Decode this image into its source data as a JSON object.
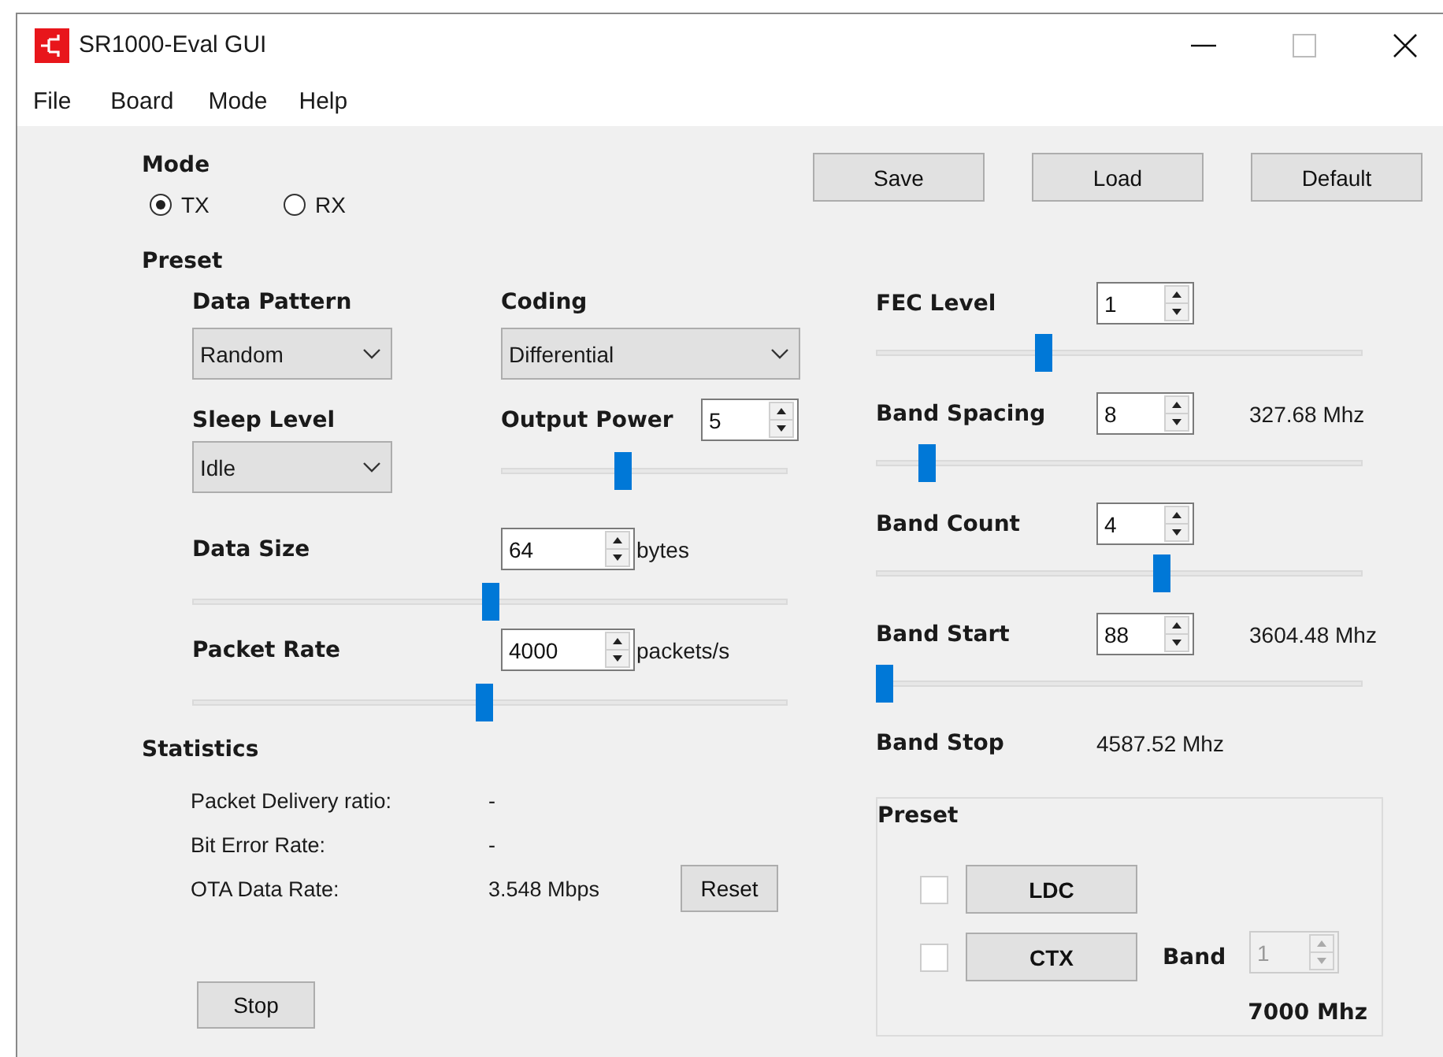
{
  "window": {
    "title": "SR1000-Eval GUI"
  },
  "menu": [
    "File",
    "Board",
    "Mode",
    "Help"
  ],
  "mode": {
    "label": "Mode",
    "options": [
      {
        "label": "TX",
        "selected": true
      },
      {
        "label": "RX",
        "selected": false
      }
    ]
  },
  "actions": [
    "Save",
    "Load",
    "Default"
  ],
  "preset": {
    "label": "Preset",
    "data_pattern": {
      "label": "Data Pattern",
      "value": "Random"
    },
    "coding": {
      "label": "Coding",
      "value": "Differential"
    },
    "sleep_level": {
      "label": "Sleep Level",
      "value": "Idle"
    },
    "output_power": {
      "label": "Output Power",
      "value": "5",
      "level": 0.42
    }
  },
  "traffic": [
    {
      "label": "Data Size",
      "value": "64",
      "unit": "bytes",
      "level": 0.5
    },
    {
      "label": "Packet Rate",
      "value": "4000",
      "unit": "packets/s",
      "level": 0.49
    }
  ],
  "statistics": {
    "title": "Statistics",
    "rows": [
      {
        "label": "Packet Delivery ratio:",
        "value": "-"
      },
      {
        "label": "Bit Error Rate:",
        "value": "-"
      },
      {
        "label": "OTA Data Rate:",
        "value": "3.548 Mbps"
      }
    ],
    "reset": "Reset"
  },
  "stop": "Stop",
  "band_params": [
    {
      "label": "FEC Level",
      "value": "1",
      "level": 0.34
    },
    {
      "label": "Band Spacing",
      "value": "8",
      "reading": "327.68 Mhz",
      "level": 0.09
    },
    {
      "label": "Band Count",
      "value": "4",
      "level": 0.59
    },
    {
      "label": "Band Start",
      "value": "88",
      "reading": "3604.48 Mhz",
      "level": 0.0
    }
  ],
  "band_stop": {
    "label": "Band Stop",
    "value": "4587.52 Mhz"
  },
  "band_preset": {
    "title": "Preset",
    "items": [
      {
        "label": "LDC",
        "checked": false
      },
      {
        "label": "CTX",
        "checked": false
      }
    ],
    "band": {
      "label": "Band",
      "value": "1",
      "disabled": true
    },
    "frequency": "7000 Mhz"
  }
}
